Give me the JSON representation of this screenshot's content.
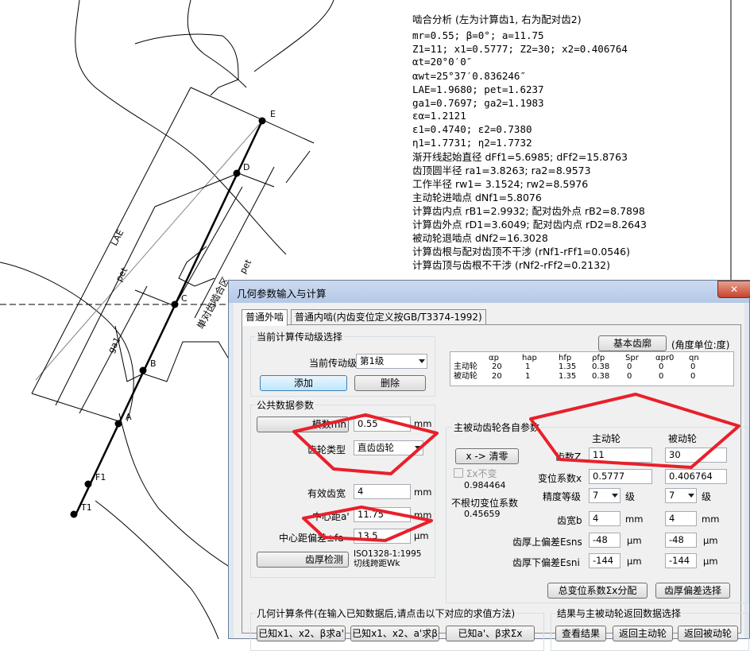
{
  "drawing": {
    "points": [
      "E",
      "D",
      "C",
      "B",
      "A",
      "F1",
      "T1"
    ],
    "dim_labels": {
      "lae": "LAE",
      "pet_left": "pet",
      "ga1": "ga1",
      "pet_right": "pet",
      "region": "単对齿啮合区"
    }
  },
  "analysis": {
    "lines": [
      "啮合分析 (左为计算齿1, 右为配对齿2)",
      "mr=0.55; β=0°; a=11.75",
      "Z1=11; x1=0.5777; Z2=30; x2=0.406764",
      "αt=20°0′0″",
      "αwt=25°37′0.836246″",
      "LAE=1.9680; pet=1.6237",
      "ga1=0.7697; ga2=1.1983",
      "εα=1.2121",
      "ε1=0.4740; ε2=0.7380",
      "η1=1.7731; η2=1.7732",
      "渐开线起始直径 dFf1=5.6985; dFf2=15.8763",
      "齿顶圆半径 ra1=3.8263; ra2=8.9573",
      "工作半径 rw1= 3.1524; rw2=8.5976",
      "主动轮进啮点 dNf1=5.8076",
      "计算齿内点 rB1=2.9932; 配对齿外点 rB2=8.7898",
      "计算齿外点 rD1=3.6049; 配对齿内点 rD2=8.2643",
      "被动轮退啮点 dNf2=16.3028",
      "计算齿根与配对齿顶不干涉 (rNf1-rFf1=0.0546)",
      "计算齿顶与齿根不干涉 (rNf2-rFf2=0.2132)"
    ]
  },
  "dialog": {
    "title": "几何参数输入与计算",
    "close": "✕",
    "tabs": [
      "普通外啮",
      "普通内啮(内齿变位定义按GB/T3374-1992)"
    ],
    "current_stage_group": "当前计算传动级选择",
    "current_stage_label": "当前传动级",
    "current_stage_value": "第1级",
    "add_btn": "添加",
    "delete_btn": "删除",
    "public_group": "公共数据参数",
    "module_label": "模数mn",
    "module_value": "0.55",
    "unit_mm": "mm",
    "tooth_type_label": "齿轮类型",
    "tooth_type_value": "直齿齿轮",
    "eff_width_label": "有效齿宽",
    "eff_width_value": "4",
    "center_label": "中心距a'",
    "center_value": "11.75",
    "center_dev_label": "中心距偏差±fa",
    "center_dev_value": "13.5",
    "unit_um": "μm",
    "tooth_check_btn": "齿厚检测",
    "std_line1": "ISO1328-1:1995",
    "std_line2": "切线跨距Wk",
    "basic_profile_btn": "基本齿廓",
    "angle_unit": "(角度单位:度)",
    "profile_table": {
      "headers": [
        "αp",
        "hap",
        "hfp",
        "ρfp",
        "Spr",
        "αpr0",
        "qn"
      ],
      "rows": [
        {
          "name": "主动轮",
          "values": [
            "20",
            "1",
            "1.35",
            "0.38",
            "0",
            "0",
            "0"
          ]
        },
        {
          "name": "被动轮",
          "values": [
            "20",
            "1",
            "1.35",
            "0.38",
            "0",
            "0",
            "0"
          ]
        }
      ]
    },
    "gear_group": "主被动齿轮各自参数",
    "clear_x_btn": "x -> 清零",
    "sum_x_check": "Σx不变",
    "sum_x_value": "0.984464",
    "no_undercut_label": "不根切变位系数",
    "no_undercut_value": "0.45659",
    "driver_header": "主动轮",
    "driven_header": "被动轮",
    "teeth_label": "齿数Z",
    "teeth_driver": "11",
    "teeth_driven": "30",
    "shift_label": "变位系数x",
    "shift_driver": "0.5777",
    "shift_driven": "0.406764",
    "grade_label": "精度等级",
    "grade_driver": "7",
    "grade_driven": "7",
    "grade_unit": "级",
    "width_label": "齿宽b",
    "width_driver": "4",
    "width_driven": "4",
    "upper_dev_label": "齿厚上偏差Esns",
    "upper_driver": "-48",
    "upper_driven": "-48",
    "lower_dev_label": "齿厚下偏差Esni",
    "lower_driver": "-144",
    "lower_driven": "-144",
    "sum_dist_btn": "总变位系数Σx分配",
    "thick_dev_btn": "齿厚偏差选择",
    "geo_group": "几何计算条件(在输入已知数据后,请点击以下对应的求值方法)",
    "geo_btn1": "已知x1、x2、β求a'",
    "geo_btn2": "已知x1、x2、a'求β",
    "geo_btn3": "已知a'、β求Σx",
    "result_group": "结果与主被动轮返回数据选择",
    "view_result_btn": "查看结果",
    "return_driver_btn": "返回主动轮",
    "return_driven_btn": "返回被动轮"
  }
}
